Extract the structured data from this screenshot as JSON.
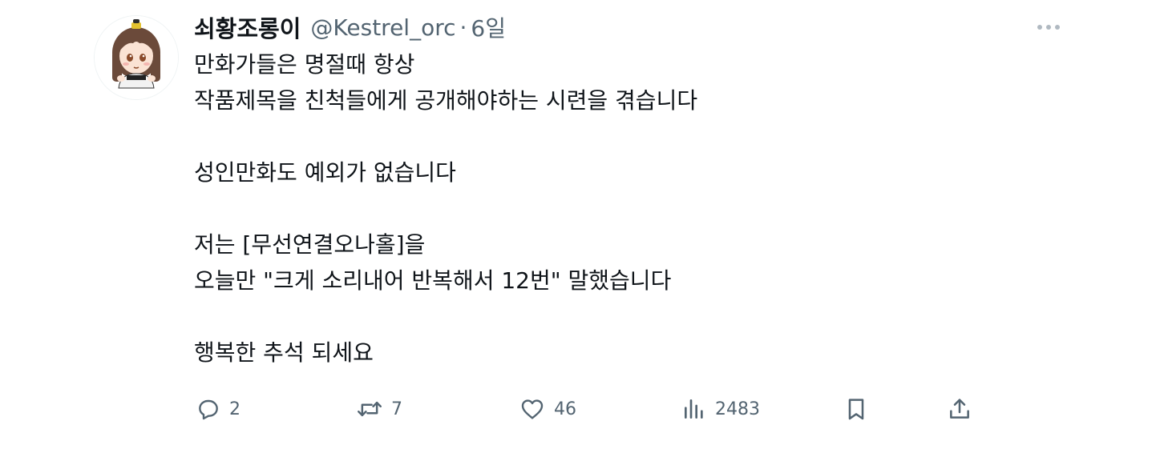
{
  "author": {
    "display_name": "쇠황조롱이",
    "handle": "@Kestrel_orc",
    "separator": "·",
    "time": "6일",
    "avatar_caption": "쇠황조롱이"
  },
  "tweet": {
    "text": "만화가들은 명절때 항상\n작품제목을 친척들에게 공개해야하는 시련을 겪습니다\n\n성인만화도 예외가 없습니다\n\n저는 [무선연결오나홀]을\n오늘만 \"크게 소리내어 반복해서 12번\" 말했습니다\n\n행복한 추석 되세요"
  },
  "actions": {
    "reply": {
      "icon": "reply-icon",
      "count": "2"
    },
    "retweet": {
      "icon": "retweet-icon",
      "count": "7"
    },
    "like": {
      "icon": "heart-icon",
      "count": "46"
    },
    "views": {
      "icon": "views-icon",
      "count": "2483"
    },
    "bookmark": {
      "icon": "bookmark-icon"
    },
    "share": {
      "icon": "share-icon"
    }
  },
  "colors": {
    "text_primary": "#0f1419",
    "text_secondary": "#536471"
  }
}
